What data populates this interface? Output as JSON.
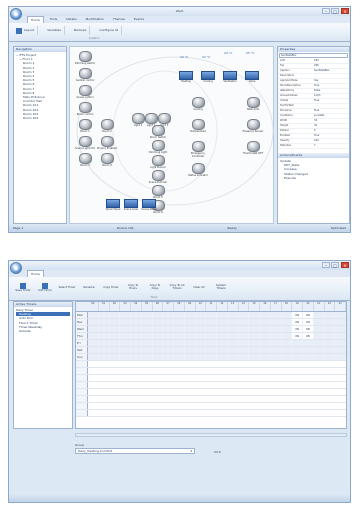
{
  "win1": {
    "title": "xPert",
    "tabs": [
      "Home",
      "Tools",
      "Details",
      "Modification",
      "Themes",
      "Events"
    ],
    "ribbon": [
      "Layout",
      "Variables",
      "Backups",
      "Configure IO"
    ],
    "ribbon_group": "Creation",
    "nav_title": "Navigation",
    "tree": [
      "− ETS Project",
      "− Floor 1",
      "Room 1",
      "Room 2",
      "Room 3",
      "Room 4",
      "Room 5",
      "Room 6",
      "Room 7",
      "Room 8",
      "Main Entrance",
      "Corridor Hall",
      "Room 101",
      "Room 102",
      "Room 103",
      "Room 104"
    ],
    "devices": {
      "left": [
        "Dimming switch",
        "Central control",
        "Scene control",
        "Room control",
        "Room 1",
        "Room 2",
        "Scene Light Ctrl",
        "Privacy Enabled",
        "Room 3",
        "Room 4"
      ],
      "mid": [
        "Light 1",
        "Light 2",
        "Light 3",
        "Room Switch",
        "Dimming Light",
        "Light Burner",
        "Scene Dimmer",
        "Room 5",
        "Room 6"
      ],
      "top": [
        "22 °C",
        "22 °C",
        "24 °C",
        "25 °C"
      ],
      "boxes": [
        "Heating",
        "Cooling",
        "Ventilation",
        "Valve"
      ],
      "right": [
        "Cooling",
        "Heat Auto",
        "Temperature",
        "Presence Sensor",
        "Emergency Controller",
        "Thermostat OFF",
        "Status Indicator"
      ],
      "bottom": [
        "Quick Panel",
        "Scene Scan",
        "Scene Panel"
      ]
    },
    "props_title": "Properties",
    "props_object": "SunSlatsBox",
    "props": [
      [
        "Left",
        "183"
      ],
      [
        "Top",
        "256"
      ],
      [
        "Caption",
        "SunSlatsBox"
      ],
      [
        "Description",
        ""
      ],
      [
        "ApplyGridSize",
        "Yes"
      ],
      [
        "ShowDescription",
        "True"
      ],
      [
        "IsReadOnly",
        "False"
      ],
      [
        "GroupAddress",
        "1/2/3"
      ],
      [
        "Visible",
        "True"
      ],
      [
        "ToolTipText",
        ""
      ],
      [
        "ShowIcon",
        "True"
      ],
      [
        "IconName",
        "sunslats"
      ],
      [
        "Width",
        "32"
      ],
      [
        "Height",
        "32"
      ],
      [
        "ZOrder",
        "5"
      ],
      [
        "Enabled",
        "True"
      ],
      [
        "Opacity",
        "100"
      ],
      [
        "TabIndex",
        "7"
      ]
    ],
    "events_title": "Actions/Events",
    "events": [
      "Update",
      "DPT_State",
      "Increase",
      "Status Changed",
      "Execute"
    ],
    "status": [
      "Page 1",
      "Rooms 102",
      "Ready",
      "Optimized"
    ]
  },
  "win2": {
    "tabs": [
      "Home"
    ],
    "ribbon": [
      "Save Timer",
      "Add Timer",
      "Select Timer",
      "Rename",
      "Copy Timer",
      "Copy To Hours",
      "Copy To Days",
      "Copy To All Timers",
      "Clear All",
      "System Timers"
    ],
    "ribbon_group": "Timer",
    "list_title": "Active Timers",
    "list": [
      "Daily Timer",
      "Heating",
      "Auto Dim",
      "Floor1 Timer",
      "Timer-Weekday",
      "Outside"
    ],
    "days": [
      "Mon",
      "Tue",
      "Wed",
      "Thu",
      "Fri",
      "Sat",
      "Sun"
    ],
    "hours": [
      "00",
      "01",
      "02",
      "03",
      "04",
      "05",
      "06",
      "07",
      "08",
      "09",
      "10",
      "11",
      "12",
      "13",
      "14",
      "15",
      "16",
      "17",
      "18",
      "19",
      "20",
      "21",
      "22",
      "23"
    ],
    "on_cells": [
      [
        "Mon",
        19,
        "ON"
      ],
      [
        "Mon",
        20,
        "ON"
      ],
      [
        "Tue",
        19,
        "ON"
      ],
      [
        "Tue",
        20,
        "ON"
      ],
      [
        "Wed",
        19,
        "ON"
      ],
      [
        "Wed",
        20,
        "ON"
      ],
      [
        "Thu",
        19,
        "ON"
      ],
      [
        "Thu",
        20,
        "ON"
      ]
    ],
    "group_label": "Group",
    "group_value": "Daily_Heating-Comfort",
    "group_value2": "23.0"
  }
}
